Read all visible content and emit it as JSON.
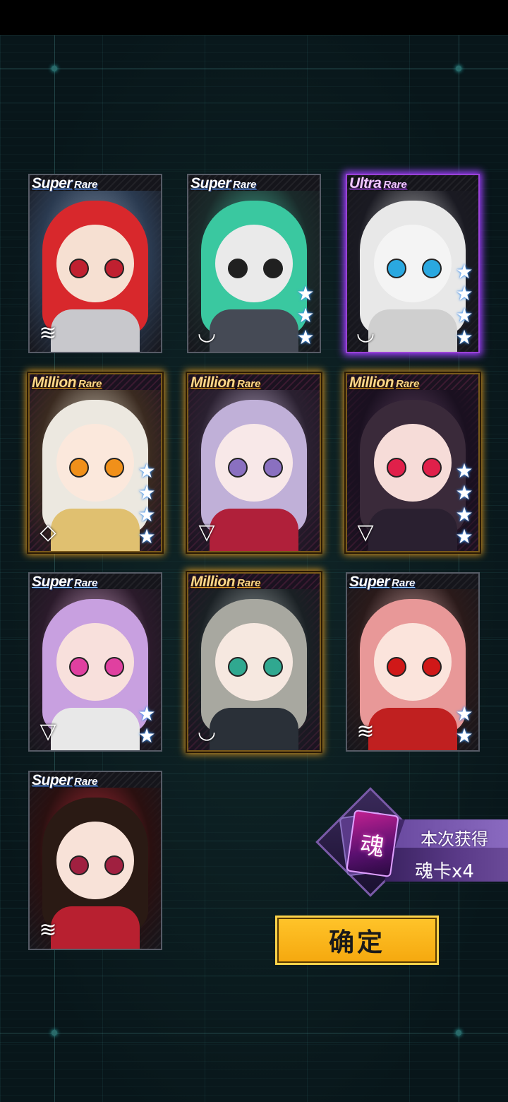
{
  "cards": [
    {
      "rarity_main": "Super",
      "rarity_sub": "Rare",
      "tier": "super",
      "stars": 0,
      "badge": "≋",
      "colors": {
        "c1": "#8a9ab0",
        "c2": "#2a3a50",
        "hair": "#d8282c",
        "skin": "#f6e0d2",
        "eye": "#c02030",
        "outfit": "#c8c8cc"
      }
    },
    {
      "rarity_main": "Super",
      "rarity_sub": "Rare",
      "tier": "super",
      "stars": 3,
      "badge": "◟◞",
      "colors": {
        "c1": "#4ac8a8",
        "c2": "#1a2a2a",
        "hair": "#3ac8a0",
        "skin": "#eaeaea",
        "eye": "#202020",
        "outfit": "#454a55"
      }
    },
    {
      "rarity_main": "Ultra",
      "rarity_sub": "Rare",
      "tier": "ultra",
      "stars": 4,
      "badge": "◟◞",
      "colors": {
        "c1": "#dadada",
        "c2": "#1a1a22",
        "hair": "#e8e8e8",
        "skin": "#f4f4f4",
        "eye": "#2aa8e0",
        "outfit": "#cfcfcf"
      }
    },
    {
      "rarity_main": "Million",
      "rarity_sub": "Rare",
      "tier": "million",
      "stars": 4,
      "badge": "◇",
      "colors": {
        "c1": "#f0ead8",
        "c2": "#3a2a20",
        "hair": "#ece8e0",
        "skin": "#fbe8dc",
        "eye": "#f0901a",
        "outfit": "#e0c070"
      }
    },
    {
      "rarity_main": "Million",
      "rarity_sub": "Rare",
      "tier": "million",
      "stars": 0,
      "badge": "▽",
      "colors": {
        "c1": "#d8c8e8",
        "c2": "#2a2030",
        "hair": "#c0b0d8",
        "skin": "#f8e8e8",
        "eye": "#8a70c0",
        "outfit": "#b0203a"
      }
    },
    {
      "rarity_main": "Million",
      "rarity_sub": "Rare",
      "tier": "million",
      "stars": 4,
      "badge": "▽",
      "colors": {
        "c1": "#6a4a6a",
        "c2": "#1a1020",
        "hair": "#3a2a3a",
        "skin": "#f6dcd8",
        "eye": "#e0204a",
        "outfit": "#2a2030"
      }
    },
    {
      "rarity_main": "Super",
      "rarity_sub": "Rare",
      "tier": "super",
      "stars": 2,
      "badge": "▽",
      "colors": {
        "c1": "#e0b0d8",
        "c2": "#2a1a2a",
        "hair": "#c8a0e0",
        "skin": "#f8e0dc",
        "eye": "#e040a0",
        "outfit": "#e8e8e8"
      }
    },
    {
      "rarity_main": "Million",
      "rarity_sub": "Rare",
      "tier": "million",
      "stars": 0,
      "badge": "◟◞",
      "colors": {
        "c1": "#b8c0c0",
        "c2": "#1a2024",
        "hair": "#a8a8a0",
        "skin": "#f6e8e0",
        "eye": "#30a890",
        "outfit": "#2a3038"
      }
    },
    {
      "rarity_main": "Super",
      "rarity_sub": "Rare",
      "tier": "super",
      "stars": 2,
      "badge": "≋",
      "colors": {
        "c1": "#e8b8b8",
        "c2": "#2a1a1a",
        "hair": "#e89898",
        "skin": "#fbe4dc",
        "eye": "#d01818",
        "outfit": "#c02020"
      }
    },
    {
      "rarity_main": "Super",
      "rarity_sub": "Rare",
      "tier": "super",
      "stars": 0,
      "badge": "≋",
      "colors": {
        "c1": "#c83040",
        "c2": "#2a1010",
        "hair": "#2a1a14",
        "skin": "#f8e2d8",
        "eye": "#a02040",
        "outfit": "#b82030"
      }
    }
  ],
  "reward": {
    "icon_char": "魂",
    "title": "本次获得",
    "count": "魂卡x4"
  },
  "confirm_label": "确定",
  "star_glyph": "★"
}
